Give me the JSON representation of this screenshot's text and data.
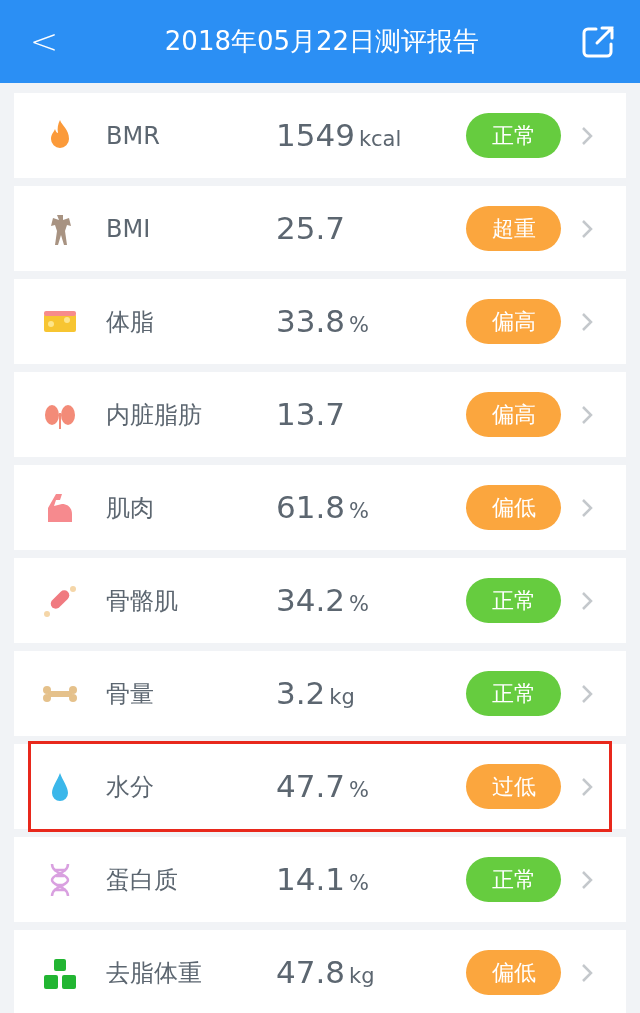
{
  "header": {
    "back": "<",
    "title": "2018年05月22日测评报告"
  },
  "rows": [
    {
      "kind": "flame",
      "name": "BMR",
      "value": "1549",
      "unit": "kcal",
      "status": "正常",
      "color": "#66cc3f",
      "highlighted": false
    },
    {
      "kind": "figure",
      "name": "BMI",
      "value": "25.7",
      "status": "超重",
      "color": "#fba63e",
      "highlighted": false
    },
    {
      "kind": "fat",
      "name": "体脂",
      "value": "33.8",
      "unit": "%",
      "status": "偏高",
      "color": "#fba63e",
      "highlighted": false
    },
    {
      "kind": "kidney",
      "name": "内脏脂肪",
      "value": "13.7",
      "status": "偏高",
      "color": "#fba63e",
      "highlighted": false
    },
    {
      "kind": "muscle",
      "name": "肌肉",
      "value": "61.8",
      "unit": "%",
      "status": "偏低",
      "color": "#fba63e",
      "highlighted": false
    },
    {
      "kind": "meat",
      "name": "骨骼肌",
      "value": "34.2",
      "unit": "%",
      "status": "正常",
      "color": "#66cc3f",
      "highlighted": false
    },
    {
      "kind": "bone",
      "name": "骨量",
      "value": "3.2",
      "unit": "kg",
      "status": "正常",
      "color": "#66cc3f",
      "highlighted": false
    },
    {
      "kind": "drop",
      "name": "水分",
      "value": "47.7",
      "unit": "%",
      "status": "过低",
      "color": "#fba63e",
      "highlighted": true
    },
    {
      "kind": "dna",
      "name": "蛋白质",
      "value": "14.1",
      "unit": "%",
      "status": "正常",
      "color": "#66cc3f",
      "highlighted": false
    },
    {
      "kind": "weights",
      "name": "去脂体重",
      "value": "47.8",
      "unit": "kg",
      "status": "偏低",
      "color": "#fba63e",
      "highlighted": false
    }
  ]
}
